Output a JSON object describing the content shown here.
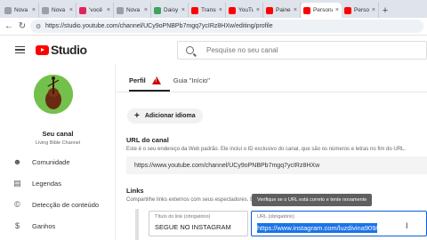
{
  "browser": {
    "tabs": [
      {
        "label": "Nova guia",
        "color": "#9aa0a6"
      },
      {
        "label": "Nova guia",
        "color": "#9aa0a6"
      },
      {
        "label": "'você só",
        "color": "#e0245e"
      },
      {
        "label": "Nova guia",
        "color": "#9aa0a6"
      },
      {
        "label": "Daisy the",
        "color": "#3ca55c"
      },
      {
        "label": "Transmiss",
        "color": "#ff0000"
      },
      {
        "label": "YouTube",
        "color": "#ff0000"
      },
      {
        "label": "Painel do",
        "color": "#ff0000"
      },
      {
        "label": "Personaliz",
        "color": "#ff0000"
      },
      {
        "label": "Person",
        "color": "#ff0000"
      }
    ],
    "url": "https://studio.youtube.com/channel/UCy9oPNBPb7mgq7ycIRz8HXw/editing/profile"
  },
  "header": {
    "logo_text": "Studio",
    "search_placeholder": "Pesquise no seu canal"
  },
  "sidebar": {
    "channel_name": "Seu canal",
    "channel_sub": "Living Bible Channel",
    "items": [
      {
        "label": "Comunidade",
        "icon": "people-icon"
      },
      {
        "label": "Legendas",
        "icon": "subtitles-icon"
      },
      {
        "label": "Detecção de conteúdo",
        "icon": "copyright-icon"
      },
      {
        "label": "Ganhos",
        "icon": "dollar-icon"
      }
    ]
  },
  "main": {
    "tabs": {
      "profile": "Perfil",
      "home": "Guia \"Início\""
    },
    "add_language": "Adicionar idioma",
    "channel_url": {
      "heading": "URL do canal",
      "description": "Este é o seu endereço da Web padrão. Ele inclui o ID exclusivo do canal, que são os números e letras no fim do URL.",
      "value": "https://www.youtube.com/channel/UCy9oPNBPb7mgq7ycIRz8HXw"
    },
    "links": {
      "heading": "Links",
      "description": "Compartilhe links externos com seus espectadores. Eles ficarão visíveis no perfil e na página \"Sobre\"",
      "tooltip": "Verifique se o URL está correto e tente novamente",
      "title_label": "Título do link (obrigatório)",
      "title_value": "SEGUE NO INSTAGRAM",
      "url_label": "URL (obrigatório)",
      "url_value": "https://www.instagram.com/luzdivina909/"
    }
  }
}
